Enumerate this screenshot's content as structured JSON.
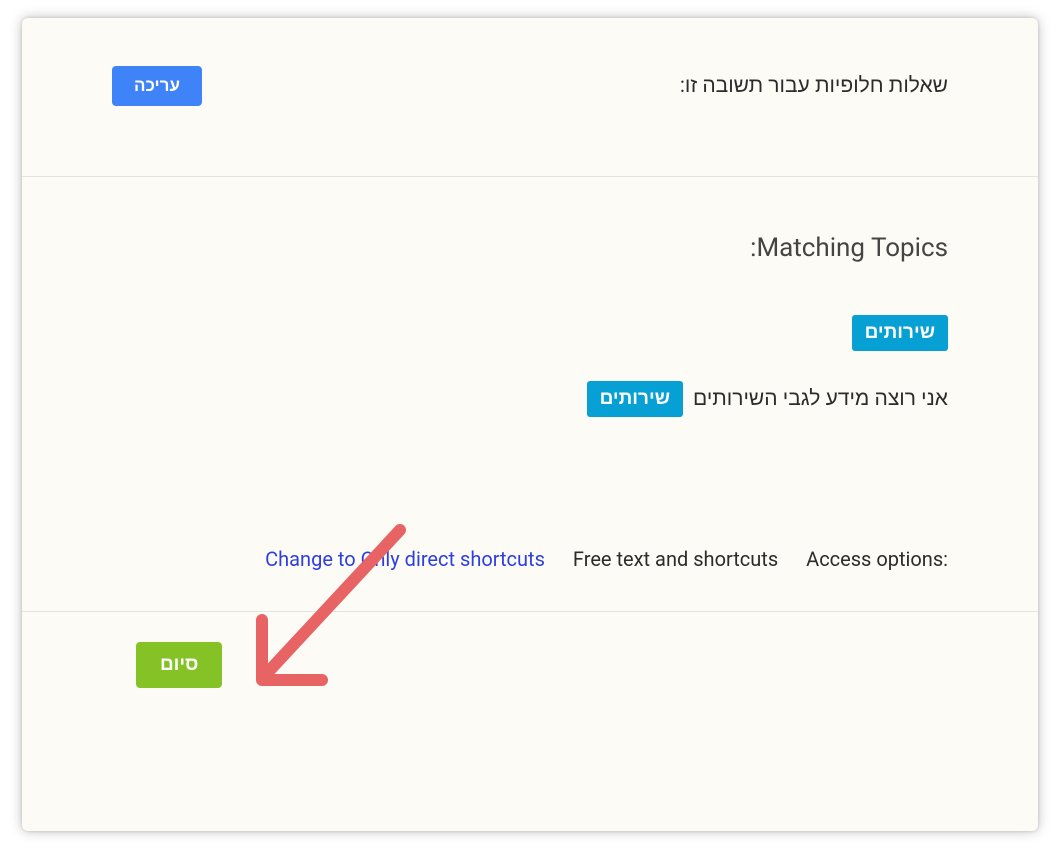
{
  "alt_questions": {
    "label": "שאלות חלופיות עבור תשובה זו:",
    "edit_button": "עריכה"
  },
  "matching_topics": {
    "title": ":Matching Topics",
    "topics": [
      {
        "chip": "שירותים",
        "text": ""
      },
      {
        "chip": "שירותים",
        "text": "אני רוצה מידע לגבי השירותים"
      }
    ]
  },
  "access": {
    "label": ":Access options",
    "current": "Free text and shortcuts",
    "change_link": "Change to Only direct shortcuts"
  },
  "finish_button": "סיום"
}
